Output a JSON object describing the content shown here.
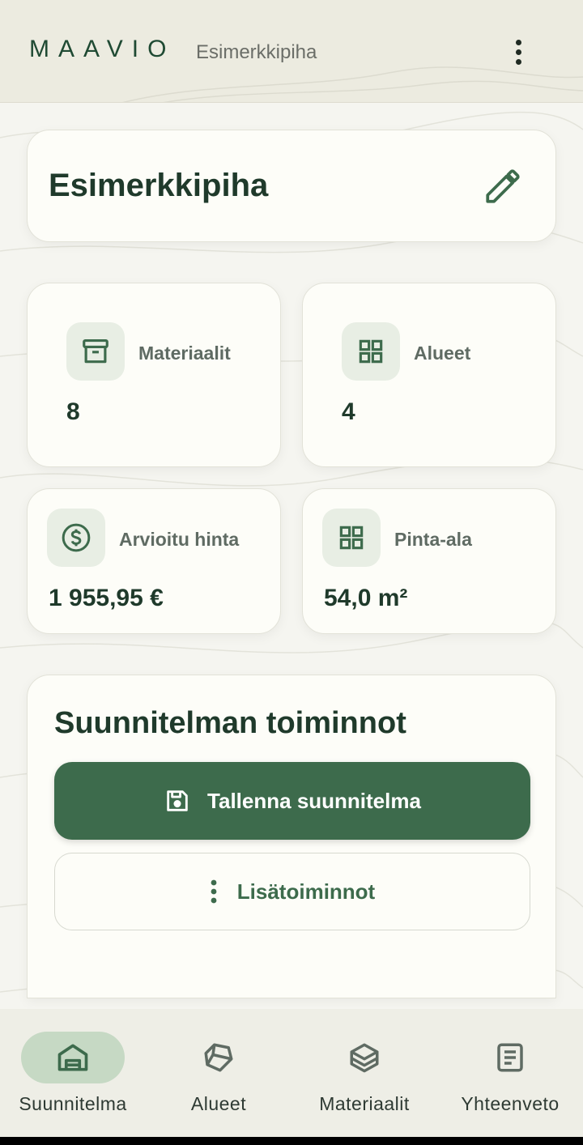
{
  "app": {
    "brand": "MAAVIO",
    "subtitle": "Esimerkkipiha",
    "menu_icon": "more-vert-icon"
  },
  "garden": {
    "name": "Esimerkkipiha",
    "edit_icon": "pencil-icon"
  },
  "stats": [
    {
      "label": "Materiaalit",
      "value": "8",
      "icon": "archive-box-icon"
    },
    {
      "label": "Alueet",
      "value": "4",
      "icon": "grid-icon"
    },
    {
      "label": "Arvioitu hinta",
      "value": "1 955,95 €",
      "icon": "dollar-circle-icon"
    },
    {
      "label": "Pinta-ala",
      "value": "54,0 m²",
      "icon": "grid-icon"
    }
  ],
  "actions": {
    "title": "Suunnitelman toiminnot",
    "save_label": "Tallenna suunnitelma",
    "save_icon": "save-icon",
    "more_label": "Lisätoiminnot",
    "more_icon": "more-vert-icon"
  },
  "nav": {
    "active": "Suunnitelma",
    "items": [
      {
        "label": "Suunnitelma",
        "icon": "house-icon"
      },
      {
        "label": "Alueet",
        "icon": "polygon-icon"
      },
      {
        "label": "Materiaalit",
        "icon": "layers-icon"
      },
      {
        "label": "Yhteenveto",
        "icon": "document-icon"
      }
    ]
  },
  "colors": {
    "primary": "#3d6b4c",
    "brand_text": "#1f4a33",
    "background": "#f5f5f0",
    "card": "#fdfdf8",
    "icon_bg": "#e8eee4",
    "nav_active": "#c6d9c4"
  }
}
